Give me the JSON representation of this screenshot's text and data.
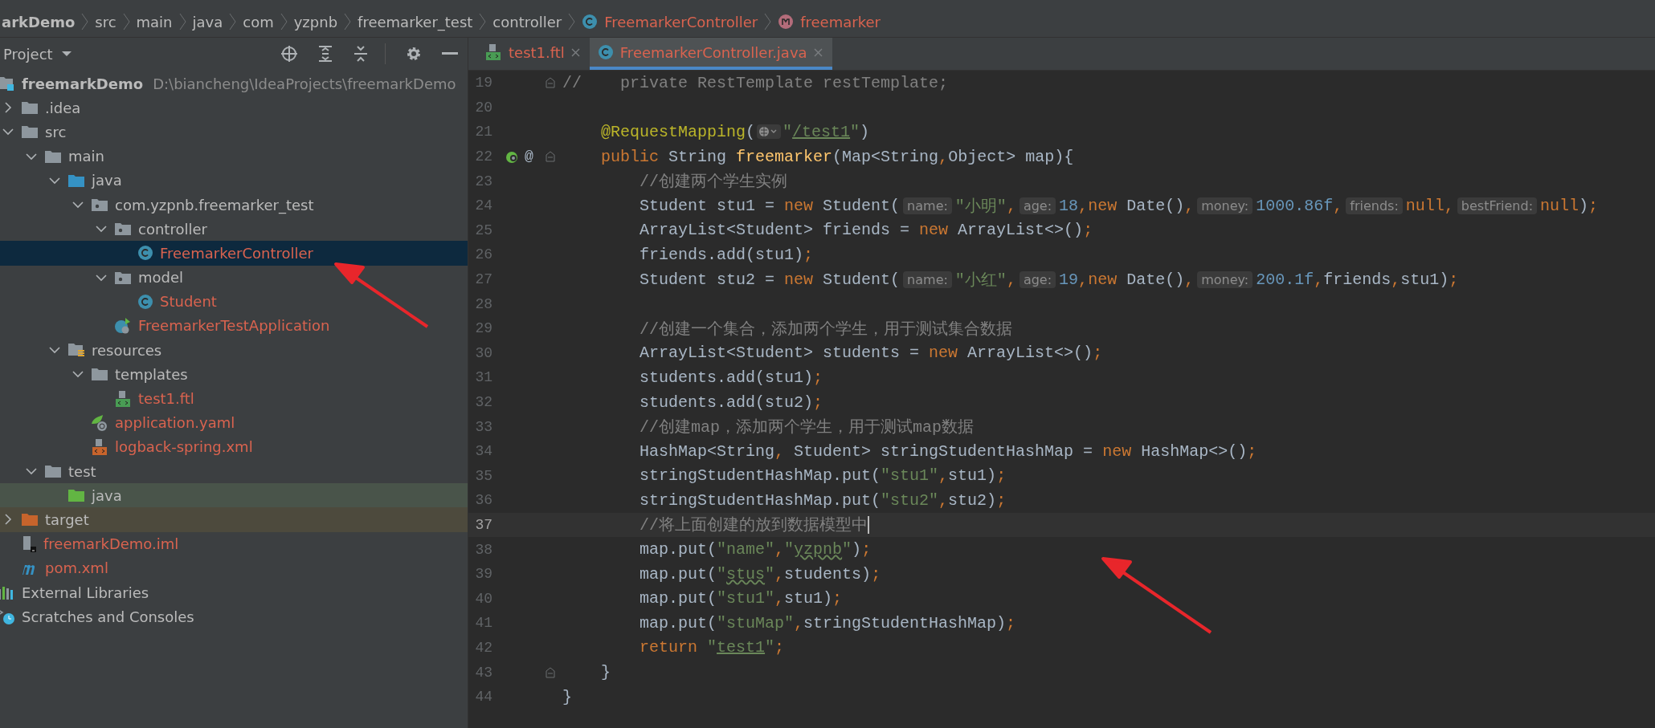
{
  "breadcrumb": [
    {
      "text": "arkDemo",
      "kind": "module",
      "modified": false
    },
    {
      "text": "src",
      "kind": "folder",
      "modified": false
    },
    {
      "text": "main",
      "kind": "folder",
      "modified": false
    },
    {
      "text": "java",
      "kind": "folder",
      "modified": false
    },
    {
      "text": "com",
      "kind": "folder",
      "modified": false
    },
    {
      "text": "yzpnb",
      "kind": "folder",
      "modified": false
    },
    {
      "text": "freemarker_test",
      "kind": "folder",
      "modified": false
    },
    {
      "text": "controller",
      "kind": "folder",
      "modified": false
    },
    {
      "text": "FreemarkerController",
      "kind": "class",
      "modified": true
    },
    {
      "text": "freemarker",
      "kind": "method",
      "modified": true
    }
  ],
  "project_panel": {
    "title": "Project"
  },
  "project_tree": [
    {
      "name": "freemarkDemo",
      "path": "D:\\biancheng\\IdeaProjects\\freemarkDemo",
      "kind": "module",
      "modified": false,
      "selected": false,
      "children": [
        {
          "name": ".idea",
          "kind": "folder",
          "modified": false,
          "selected": false,
          "expanded": false
        },
        {
          "name": "src",
          "kind": "folder",
          "modified": false,
          "selected": false,
          "expanded": true,
          "children": [
            {
              "name": "main",
              "kind": "folder",
              "modified": false,
              "selected": false,
              "expanded": true,
              "children": [
                {
                  "name": "java",
                  "kind": "source-root",
                  "modified": false,
                  "selected": false,
                  "expanded": true,
                  "children": [
                    {
                      "name": "com.yzpnb.freemarker_test",
                      "kind": "package",
                      "modified": false,
                      "selected": false,
                      "expanded": true,
                      "children": [
                        {
                          "name": "controller",
                          "kind": "package",
                          "modified": false,
                          "selected": false,
                          "expanded": true,
                          "children": [
                            {
                              "name": "FreemarkerController",
                              "kind": "class",
                              "modified": true,
                              "selected": true
                            }
                          ]
                        },
                        {
                          "name": "model",
                          "kind": "package",
                          "modified": false,
                          "selected": false,
                          "expanded": true,
                          "children": [
                            {
                              "name": "Student",
                              "kind": "class",
                              "modified": true,
                              "selected": false
                            }
                          ]
                        },
                        {
                          "name": "FreemarkerTestApplication",
                          "kind": "spring-class",
                          "modified": true,
                          "selected": false
                        }
                      ]
                    }
                  ]
                },
                {
                  "name": "resources",
                  "kind": "resources-root",
                  "modified": false,
                  "selected": false,
                  "expanded": true,
                  "children": [
                    {
                      "name": "templates",
                      "kind": "folder",
                      "modified": false,
                      "selected": false,
                      "expanded": true,
                      "children": [
                        {
                          "name": "test1.ftl",
                          "kind": "ftl",
                          "modified": true,
                          "selected": false
                        }
                      ]
                    },
                    {
                      "name": "application.yaml",
                      "kind": "spring-config",
                      "modified": true,
                      "selected": false
                    },
                    {
                      "name": "logback-spring.xml",
                      "kind": "xml",
                      "modified": true,
                      "selected": false
                    }
                  ]
                }
              ]
            },
            {
              "name": "test",
              "kind": "folder",
              "modified": false,
              "selected": false,
              "expanded": true,
              "children": [
                {
                  "name": "java",
                  "kind": "test-root",
                  "modified": false,
                  "selected": false
                }
              ]
            }
          ]
        },
        {
          "name": "target",
          "kind": "excluded",
          "modified": false,
          "selected": false,
          "expanded": false
        },
        {
          "name": "freemarkDemo.iml",
          "kind": "iml",
          "modified": true,
          "selected": false
        },
        {
          "name": "pom.xml",
          "kind": "maven",
          "modified": true,
          "selected": false
        }
      ]
    },
    {
      "name": "External Libraries",
      "kind": "libraries",
      "modified": false,
      "selected": false
    },
    {
      "name": "Scratches and Consoles",
      "kind": "scratches",
      "modified": false,
      "selected": false
    }
  ],
  "tabs": [
    {
      "label": "test1.ftl",
      "kind": "ftl",
      "modified": true,
      "selected": false
    },
    {
      "label": "FreemarkerController.java",
      "kind": "class",
      "modified": true,
      "selected": true
    }
  ],
  "code": {
    "lines": [
      {
        "number": "19",
        "fold": true,
        "tokens": [
          {
            "kind": "comment",
            "text": "//    private RestTemplate restTemplate;"
          }
        ]
      },
      {
        "number": "20"
      },
      {
        "number": "21",
        "tokens": [
          {
            "kind": "annotation",
            "text": "    @RequestMapping"
          },
          {
            "kind": "plain",
            "text": "("
          },
          {
            "kind": "url-icon"
          },
          {
            "kind": "string",
            "text": "\""
          },
          {
            "kind": "link",
            "text": "/test1"
          },
          {
            "kind": "string",
            "text": "\""
          },
          {
            "kind": "plain",
            "text": ")"
          }
        ]
      },
      {
        "number": "22",
        "fold": true,
        "gutter": "@",
        "tokens": [
          {
            "kind": "keyword",
            "text": "    public"
          },
          {
            "kind": "plain",
            "text": " String "
          },
          {
            "kind": "method",
            "text": "freemarker"
          },
          {
            "kind": "plain",
            "text": "(Map<String"
          },
          {
            "kind": "punct",
            "text": ","
          },
          {
            "kind": "plain",
            "text": "Object> map){"
          }
        ]
      },
      {
        "number": "23",
        "tokens": [
          {
            "kind": "comment",
            "text": "        //创建两个学生实例"
          }
        ]
      },
      {
        "number": "24",
        "tokens": [
          {
            "kind": "plain",
            "text": "        Student stu1 = "
          },
          {
            "kind": "keyword",
            "text": "new"
          },
          {
            "kind": "plain",
            "text": " Student("
          },
          {
            "kind": "hint",
            "text": "name:"
          },
          {
            "kind": "string",
            "text": "\"小明\""
          },
          {
            "kind": "punct",
            "text": ","
          },
          {
            "kind": "hint",
            "text": "age:"
          },
          {
            "kind": "number",
            "text": "18"
          },
          {
            "kind": "punct",
            "text": ","
          },
          {
            "kind": "keyword",
            "text": "new"
          },
          {
            "kind": "plain",
            "text": " Date()"
          },
          {
            "kind": "punct",
            "text": ","
          },
          {
            "kind": "hint",
            "text": "money:"
          },
          {
            "kind": "number",
            "text": "1000.86f"
          },
          {
            "kind": "punct",
            "text": ","
          },
          {
            "kind": "hint",
            "text": "friends:"
          },
          {
            "kind": "keyword",
            "text": "null"
          },
          {
            "kind": "punct",
            "text": ","
          },
          {
            "kind": "hint",
            "text": "bestFriend:"
          },
          {
            "kind": "keyword",
            "text": "null"
          },
          {
            "kind": "plain",
            "text": ")"
          },
          {
            "kind": "punct",
            "text": ";"
          }
        ]
      },
      {
        "number": "25",
        "tokens": [
          {
            "kind": "plain",
            "text": "        ArrayList<Student> friends = "
          },
          {
            "kind": "keyword",
            "text": "new"
          },
          {
            "kind": "plain",
            "text": " ArrayList<>()"
          },
          {
            "kind": "punct",
            "text": ";"
          }
        ]
      },
      {
        "number": "26",
        "tokens": [
          {
            "kind": "plain",
            "text": "        friends.add(stu1)"
          },
          {
            "kind": "punct",
            "text": ";"
          }
        ]
      },
      {
        "number": "27",
        "tokens": [
          {
            "kind": "plain",
            "text": "        Student stu2 = "
          },
          {
            "kind": "keyword",
            "text": "new"
          },
          {
            "kind": "plain",
            "text": " Student("
          },
          {
            "kind": "hint",
            "text": "name:"
          },
          {
            "kind": "string",
            "text": "\"小红\""
          },
          {
            "kind": "punct",
            "text": ","
          },
          {
            "kind": "hint",
            "text": "age:"
          },
          {
            "kind": "number",
            "text": "19"
          },
          {
            "kind": "punct",
            "text": ","
          },
          {
            "kind": "keyword",
            "text": "new"
          },
          {
            "kind": "plain",
            "text": " Date()"
          },
          {
            "kind": "punct",
            "text": ","
          },
          {
            "kind": "hint",
            "text": "money:"
          },
          {
            "kind": "number",
            "text": "200.1f"
          },
          {
            "kind": "punct",
            "text": ","
          },
          {
            "kind": "plain",
            "text": "friends"
          },
          {
            "kind": "punct",
            "text": ","
          },
          {
            "kind": "plain",
            "text": "stu1)"
          },
          {
            "kind": "punct",
            "text": ";"
          }
        ]
      },
      {
        "number": "28"
      },
      {
        "number": "29",
        "tokens": [
          {
            "kind": "comment",
            "text": "        //创建一个集合，添加两个学生，用于测试集合数据"
          }
        ]
      },
      {
        "number": "30",
        "tokens": [
          {
            "kind": "plain",
            "text": "        ArrayList<Student> students = "
          },
          {
            "kind": "keyword",
            "text": "new"
          },
          {
            "kind": "plain",
            "text": " ArrayList<>()"
          },
          {
            "kind": "punct",
            "text": ";"
          }
        ]
      },
      {
        "number": "31",
        "tokens": [
          {
            "kind": "plain",
            "text": "        students.add(stu1)"
          },
          {
            "kind": "punct",
            "text": ";"
          }
        ]
      },
      {
        "number": "32",
        "tokens": [
          {
            "kind": "plain",
            "text": "        students.add(stu2)"
          },
          {
            "kind": "punct",
            "text": ";"
          }
        ]
      },
      {
        "number": "33",
        "tokens": [
          {
            "kind": "comment",
            "text": "        //创建map，添加两个学生，用于测试map数据"
          }
        ]
      },
      {
        "number": "34",
        "tokens": [
          {
            "kind": "plain",
            "text": "        HashMap<String"
          },
          {
            "kind": "punct",
            "text": ","
          },
          {
            "kind": "plain",
            "text": " Student> stringStudentHashMap = "
          },
          {
            "kind": "keyword",
            "text": "new"
          },
          {
            "kind": "plain",
            "text": " HashMap<>()"
          },
          {
            "kind": "punct",
            "text": ";"
          }
        ]
      },
      {
        "number": "35",
        "tokens": [
          {
            "kind": "plain",
            "text": "        stringStudentHashMap.put("
          },
          {
            "kind": "string",
            "text": "\"stu1\""
          },
          {
            "kind": "punct",
            "text": ","
          },
          {
            "kind": "plain",
            "text": "stu1)"
          },
          {
            "kind": "punct",
            "text": ";"
          }
        ]
      },
      {
        "number": "36",
        "tokens": [
          {
            "kind": "plain",
            "text": "        stringStudentHashMap.put("
          },
          {
            "kind": "string",
            "text": "\"stu2\""
          },
          {
            "kind": "punct",
            "text": ","
          },
          {
            "kind": "plain",
            "text": "stu2)"
          },
          {
            "kind": "punct",
            "text": ";"
          }
        ]
      },
      {
        "number": "37",
        "current": true,
        "tokens": [
          {
            "kind": "comment",
            "text": "        //将上面创建的放到数据模型中"
          }
        ]
      },
      {
        "number": "38",
        "tokens": [
          {
            "kind": "plain",
            "text": "        map.put("
          },
          {
            "kind": "string",
            "text": "\"name\""
          },
          {
            "kind": "punct",
            "text": ","
          },
          {
            "kind": "string",
            "text": "\""
          },
          {
            "kind": "typo",
            "text": "yzpnb"
          },
          {
            "kind": "string",
            "text": "\""
          },
          {
            "kind": "plain",
            "text": ")"
          },
          {
            "kind": "punct",
            "text": ";"
          }
        ]
      },
      {
        "number": "39",
        "tokens": [
          {
            "kind": "plain",
            "text": "        map.put("
          },
          {
            "kind": "string",
            "text": "\""
          },
          {
            "kind": "typo",
            "text": "stus"
          },
          {
            "kind": "string",
            "text": "\""
          },
          {
            "kind": "punct",
            "text": ","
          },
          {
            "kind": "plain",
            "text": "students)"
          },
          {
            "kind": "punct",
            "text": ";"
          }
        ]
      },
      {
        "number": "40",
        "tokens": [
          {
            "kind": "plain",
            "text": "        map.put("
          },
          {
            "kind": "string",
            "text": "\"stu1\""
          },
          {
            "kind": "punct",
            "text": ","
          },
          {
            "kind": "plain",
            "text": "stu1)"
          },
          {
            "kind": "punct",
            "text": ";"
          }
        ]
      },
      {
        "number": "41",
        "tokens": [
          {
            "kind": "plain",
            "text": "        map.put("
          },
          {
            "kind": "string",
            "text": "\"stuMap\""
          },
          {
            "kind": "punct",
            "text": ","
          },
          {
            "kind": "plain",
            "text": "stringStudentHashMap)"
          },
          {
            "kind": "punct",
            "text": ";"
          }
        ]
      },
      {
        "number": "42",
        "tokens": [
          {
            "kind": "keyword",
            "text": "        return "
          },
          {
            "kind": "string",
            "text": "\""
          },
          {
            "kind": "link",
            "text": "test1"
          },
          {
            "kind": "string",
            "text": "\""
          },
          {
            "kind": "punct",
            "text": ";"
          }
        ]
      },
      {
        "number": "43",
        "fold": true,
        "tokens": [
          {
            "kind": "plain",
            "text": "    }"
          }
        ]
      },
      {
        "number": "44",
        "tokens": [
          {
            "kind": "plain",
            "text": "}"
          }
        ]
      }
    ]
  }
}
